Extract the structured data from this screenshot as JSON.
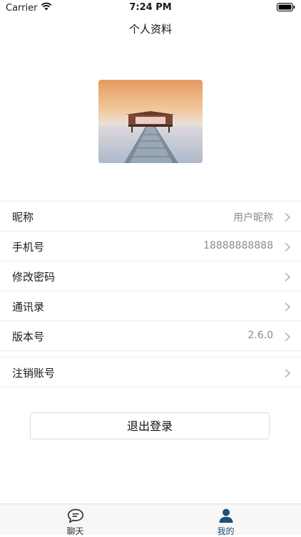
{
  "status_bar": {
    "carrier": "Carrier",
    "time": "7:24 PM"
  },
  "header": {
    "title": "个人资料"
  },
  "profile": {
    "rows": [
      {
        "label": "昵称",
        "value": "用户昵称"
      },
      {
        "label": "手机号",
        "value": "18888888888"
      },
      {
        "label": "修改密码",
        "value": ""
      },
      {
        "label": "通讯录",
        "value": ""
      },
      {
        "label": "版本号",
        "value": "2.6.0"
      }
    ],
    "extra_rows": [
      {
        "label": "注销账号",
        "value": ""
      }
    ]
  },
  "actions": {
    "logout_label": "退出登录"
  },
  "tab_bar": {
    "tabs": [
      {
        "label": "聊天",
        "icon": "chat-bubble-icon",
        "active": false
      },
      {
        "label": "我的",
        "icon": "person-icon",
        "active": true
      }
    ],
    "active_color": "#1f4e79",
    "inactive_color": "#333333"
  }
}
